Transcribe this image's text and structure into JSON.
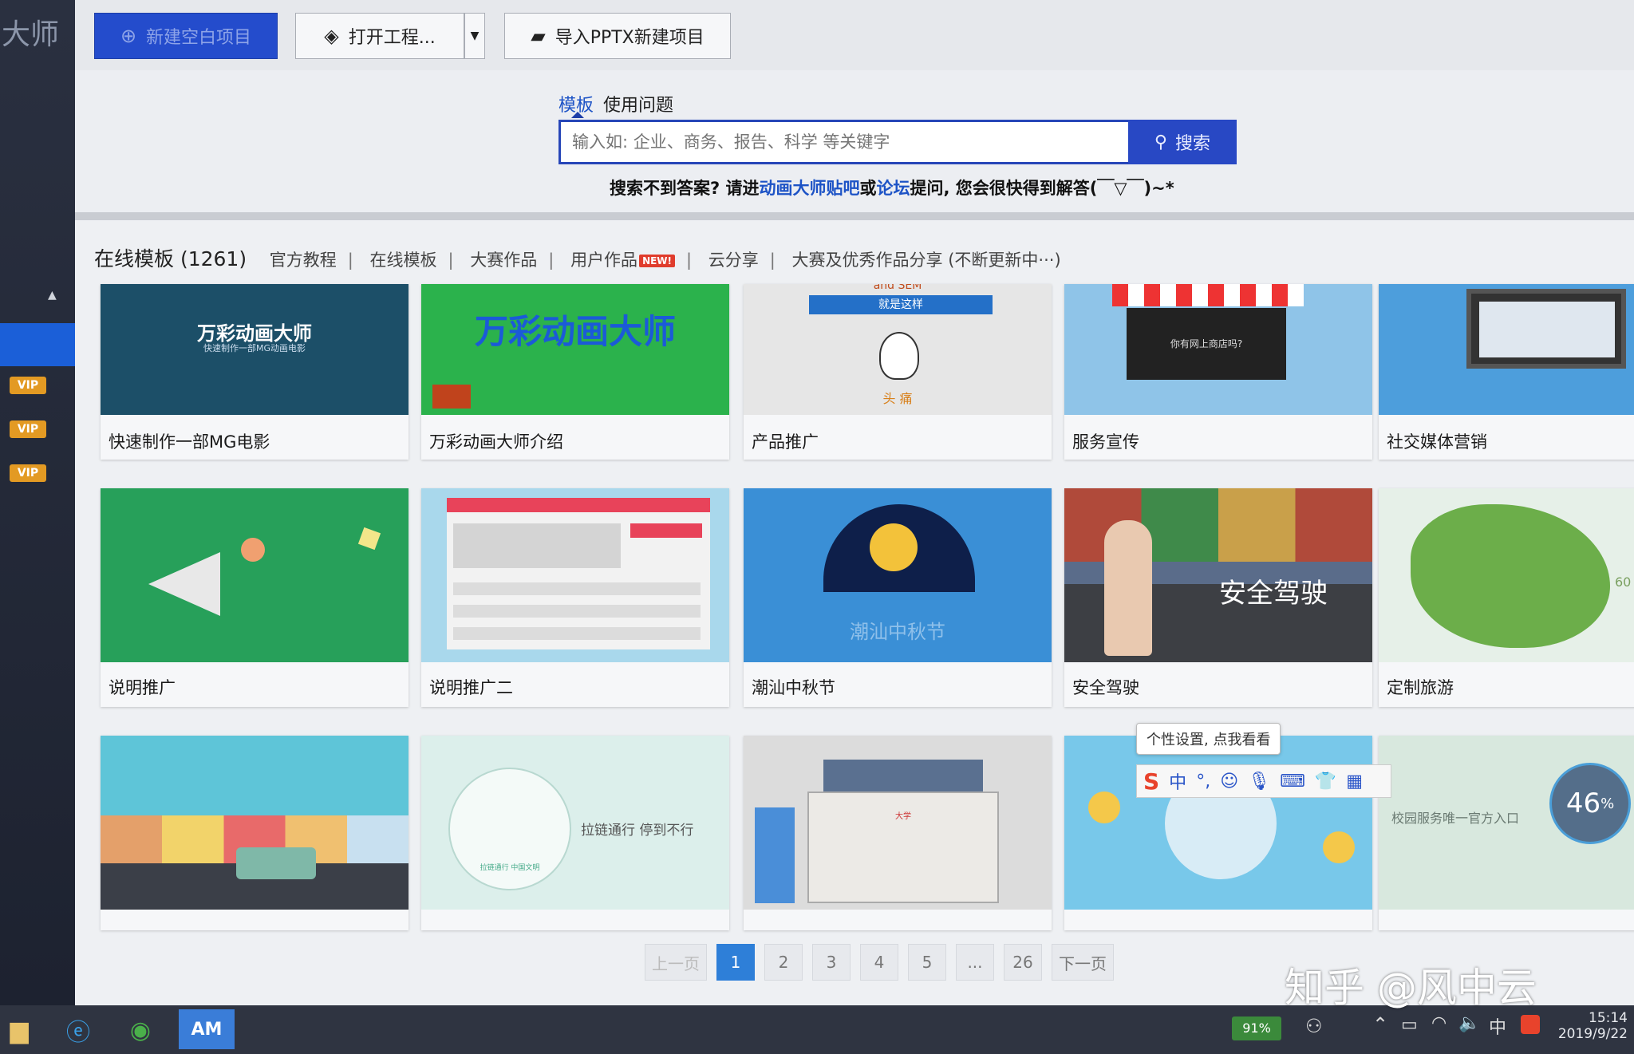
{
  "sidebar": {
    "brand": "大师",
    "vip_badges": [
      "VIP",
      "VIP",
      "VIP"
    ]
  },
  "toolbar": {
    "new_project": "新建空白项目",
    "open_project": "打开工程...",
    "import_pptx": "导入PPTX新建项目"
  },
  "search": {
    "tabs": [
      "模板",
      "使用问题"
    ],
    "placeholder": "输入如: 企业、商务、报告、科学 等关键字",
    "button": "搜索",
    "help_prefix": "搜索不到答案? 请进",
    "help_link1": "动画大师贴吧",
    "help_or": "或",
    "help_link2": "论坛",
    "help_suffix": "提问, 您会很快得到解答(￣▽￣)~*"
  },
  "categories": {
    "count_label": "在线模板 (1261)",
    "items": [
      "官方教程",
      "在线模板",
      "大赛作品",
      "用户作品",
      "云分享",
      "大赛及优秀作品分享 (不断更新中···)"
    ],
    "new_badge": "NEW!"
  },
  "templates": [
    {
      "title": "快速制作一部MG电影",
      "thumb_text": "万彩动画大师",
      "thumb_sub": "快速制作一部MG动画电影"
    },
    {
      "title": "万彩动画大师介绍",
      "thumb_text": "万彩动画大师"
    },
    {
      "title": "产品推广",
      "thumb_text": "就是这样",
      "thumb_sub": "头 痛",
      "thumb_top": "and SEM"
    },
    {
      "title": "服务宣传",
      "thumb_text": "你有网上商店吗?"
    },
    {
      "title": "社交媒体营销"
    },
    {
      "title": "说明推广"
    },
    {
      "title": "说明推广二"
    },
    {
      "title": "潮汕中秋节",
      "thumb_text": "潮汕中秋节"
    },
    {
      "title": "安全驾驶",
      "thumb_text": "安全驾驶"
    },
    {
      "title": "定制旅游",
      "thumb_text": "60"
    },
    {
      "title": "",
      "thumb_text": ""
    },
    {
      "title": "",
      "thumb_text": "拉链通行  停到不行",
      "thumb_sub": "拉链通行 中国文明"
    },
    {
      "title": "",
      "thumb_text": "大学"
    },
    {
      "title": "",
      "thumb_text": ""
    },
    {
      "title": "",
      "thumb_text": "校园服务唯一官方入口"
    }
  ],
  "pagination": {
    "prev": "上一页",
    "pages": [
      "1",
      "2",
      "3",
      "4",
      "5",
      "...",
      "26"
    ],
    "next": "下一页",
    "current": "1"
  },
  "ime": {
    "tooltip": "个性设置, 点我看看",
    "logo": "S",
    "lang": "中"
  },
  "perf": {
    "value": "46",
    "unit": "%"
  },
  "taskbar": {
    "app_label": "AM",
    "battery": "91%",
    "time": "15:14",
    "date": "2019/9/22",
    "ime_lang": "中"
  },
  "watermark": "知乎 @风中云",
  "colors": {
    "accent": "#244ccc",
    "page_current": "#2e7fd8",
    "vip": "#e39a23"
  }
}
